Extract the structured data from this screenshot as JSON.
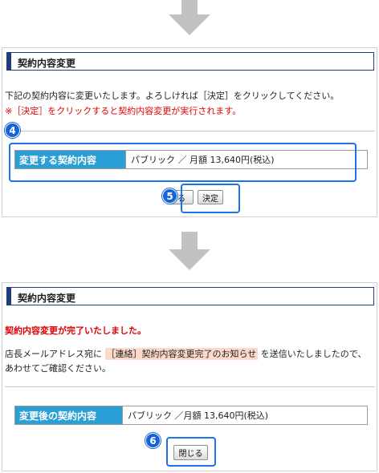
{
  "step1": {
    "heading": "契約内容変更",
    "intro": "下記の契約内容に変更いたします。よろしければ［決定］をクリックしてください。",
    "warning": "※［決定］をクリックすると契約内容変更が実行されます。",
    "badge": "4",
    "table": {
      "label": "変更する契約内容",
      "value": "パブリック ／ 月額 13,640円(税込)"
    },
    "back_label": "戻る",
    "back_visible": "る",
    "decide_label": "決定",
    "badge2": "5"
  },
  "step2": {
    "heading": "契約内容変更",
    "done": "契約内容変更が完了いたしました。",
    "sent_pre": "店長メールアドレス宛に",
    "sent_highlight": "［連絡］契約内容変更完了のお知らせ",
    "sent_post": "を送信いたしましたので、",
    "sent_line2": "あわせてご確認ください。",
    "table": {
      "label": "変更後の契約内容",
      "value": "パブリック ／月額 13,640円(税込)"
    },
    "close_label": "閉じる",
    "badge": "6"
  },
  "colors": {
    "accent": "#2a9fd6",
    "highlight_box": "#1a73e8",
    "badge": "#1565d8",
    "warning": "#e00000",
    "heading_bar": "#1f3d78"
  },
  "icons": [
    "down-arrow-icon",
    "down-arrow-icon"
  ]
}
